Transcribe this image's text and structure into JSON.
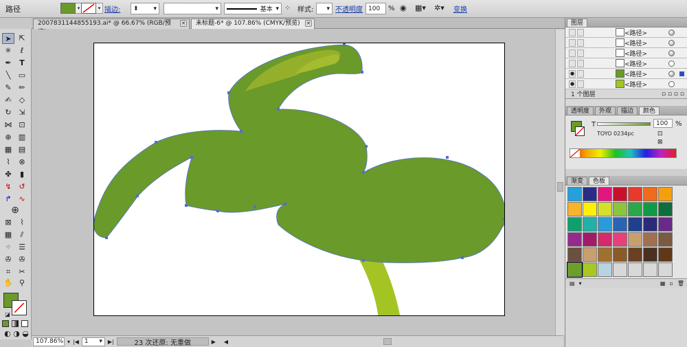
{
  "control_bar": {
    "object_type": "路径",
    "stroke_label": "描边:",
    "stroke_style": "基本",
    "style_label": "样式:",
    "opacity_label": "不透明度",
    "opacity_value": "100",
    "opacity_unit": "%",
    "transform_label": "变换"
  },
  "tabs": [
    {
      "label": "2007831144855193.ai* @ 66.67% (RGB/预览)",
      "active": false
    },
    {
      "label": "未标题-6* @ 107.86% (CMYK/预览)",
      "active": true
    }
  ],
  "layers_panel": {
    "title": "图层",
    "rows": [
      "<路径>",
      "<路径>",
      "<路径>",
      "<路径>",
      "<路径>",
      "<路径>"
    ],
    "footer": "1 个图层"
  },
  "color_panel": {
    "tabs": [
      "透明度",
      "外观",
      "描边",
      "颜色"
    ],
    "tint_label": "T",
    "tint_value": "100",
    "tint_unit": "%",
    "swatch_name": "TOYO 0234pc"
  },
  "swatch_panel": {
    "tabs": [
      "渐变",
      "色板"
    ],
    "colors": [
      "#24a0dc",
      "#2a2d86",
      "#e4157f",
      "#c8102e",
      "#e83a2c",
      "#ee6c1c",
      "#f4a00c",
      "#f6b32c",
      "#fff200",
      "#d4e02c",
      "#8cc43c",
      "#2aa84a",
      "#109a48",
      "#0e6e3c",
      "#10a070",
      "#22b0a8",
      "#2a9ad8",
      "#2b64b0",
      "#1f3f8f",
      "#2c2a7a",
      "#6a2a88",
      "#962a8c",
      "#a21a6a",
      "#d62a6a",
      "#e8407a",
      "#c8a070",
      "#a07050",
      "#7a5a40",
      "#6a5040",
      "#c8a070",
      "#a07030",
      "#8a5a28",
      "#6a4020",
      "#4a3020",
      "#603818",
      "#6aa02a",
      "#a8c820",
      "#b8d4e0",
      "#d8d8d8",
      "#d8d8d8",
      "#d8d8d8",
      "#d8d8d8"
    ]
  },
  "fill_color": "#6a9a2a",
  "status_bar": {
    "zoom": "107.86%",
    "page": "1",
    "message": "23 次还原: 无重做"
  }
}
